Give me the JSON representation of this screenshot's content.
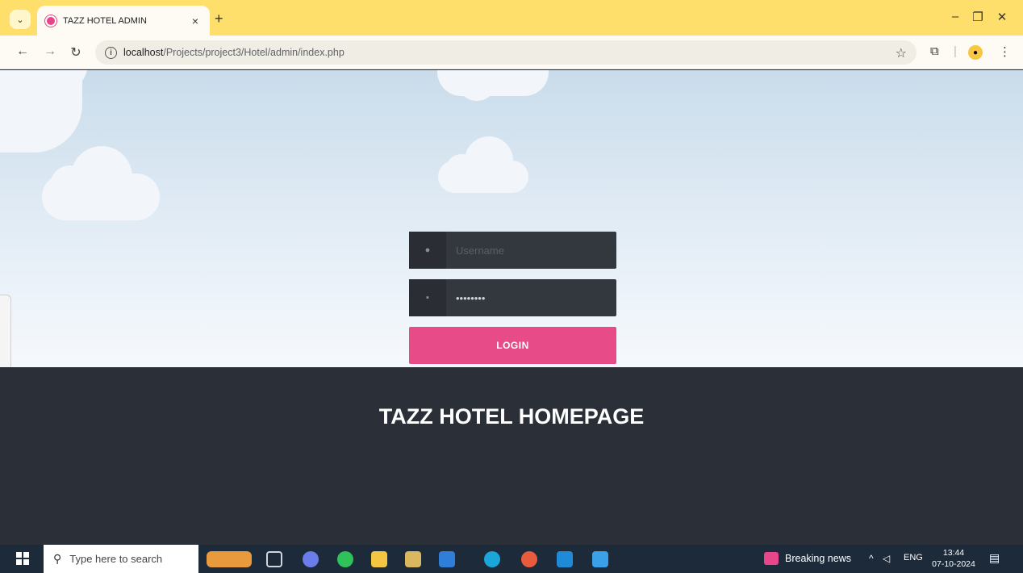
{
  "browser": {
    "tab_title": "TAZZ HOTEL ADMIN",
    "tab_close": "×",
    "new_tab": "+",
    "url_host": "localhost",
    "url_path": "/Projects/project3/Hotel/admin/index.php",
    "controls": {
      "minimize": "–",
      "restore": "❐",
      "close": "✕"
    },
    "nav": {
      "back": "←",
      "forward": "→",
      "reload": "↻"
    }
  },
  "login": {
    "username_placeholder": "Username",
    "password_value": "password",
    "button_label": "LOGIN"
  },
  "footer": {
    "title": "TAZZ HOTEL HOMEPAGE"
  },
  "taskbar": {
    "search_placeholder": "Type here to search",
    "news_label": "Breaking news",
    "language": "ENG",
    "time": "13:44",
    "date": "07-10-2024"
  },
  "colors": {
    "accent": "#e84c88",
    "tabbar": "#fedf6b",
    "footer_bg": "#2b3038",
    "field_bg": "#33383f"
  }
}
